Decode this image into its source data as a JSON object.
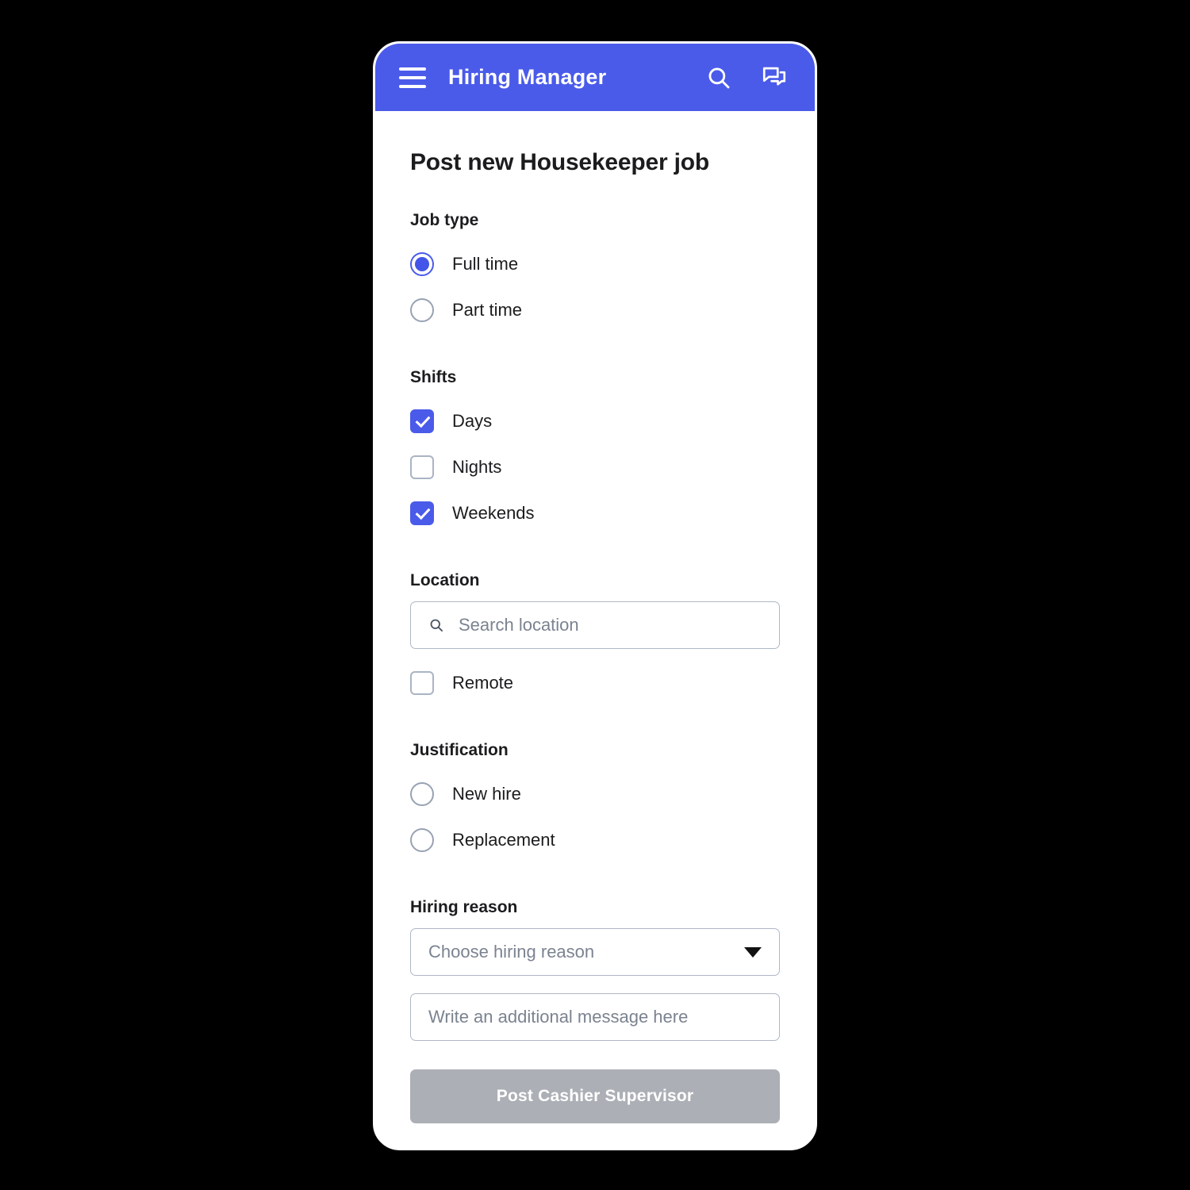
{
  "app_bar": {
    "menu_icon": "hamburger-menu-icon",
    "title": "Hiring Manager",
    "search_icon": "search-icon",
    "chat_icon": "forum-chat-icon"
  },
  "page": {
    "title": "Post new Housekeeper job"
  },
  "job_type": {
    "label": "Job type",
    "options": [
      {
        "label": "Full time",
        "selected": true
      },
      {
        "label": "Part time",
        "selected": false
      }
    ]
  },
  "shifts": {
    "label": "Shifts",
    "options": [
      {
        "label": "Days",
        "checked": true
      },
      {
        "label": "Nights",
        "checked": false
      },
      {
        "label": "Weekends",
        "checked": true
      }
    ]
  },
  "location": {
    "label": "Location",
    "search": {
      "placeholder": "Search location",
      "value": "",
      "icon": "search-icon"
    },
    "remote": {
      "label": "Remote",
      "checked": false
    }
  },
  "justification": {
    "label": "Justification",
    "options": [
      {
        "label": "New hire",
        "selected": false
      },
      {
        "label": "Replacement",
        "selected": false
      }
    ]
  },
  "hiring_reason": {
    "label": "Hiring reason",
    "select": {
      "placeholder": "Choose hiring reason",
      "value": "",
      "icon": "chevron-down-icon"
    },
    "message": {
      "placeholder": "Write an additional message here",
      "value": ""
    }
  },
  "submit": {
    "label": "Post Cashier Supervisor",
    "disabled": true
  },
  "colors": {
    "accent": "#4a5bea",
    "accent_fill": "#4255e8",
    "page_background": "#000000",
    "surface": "#ffffff",
    "text": "#1c1c1e",
    "placeholder": "#7b8390",
    "border": "#aeb8c7",
    "disabled_button": "#acafb5"
  }
}
